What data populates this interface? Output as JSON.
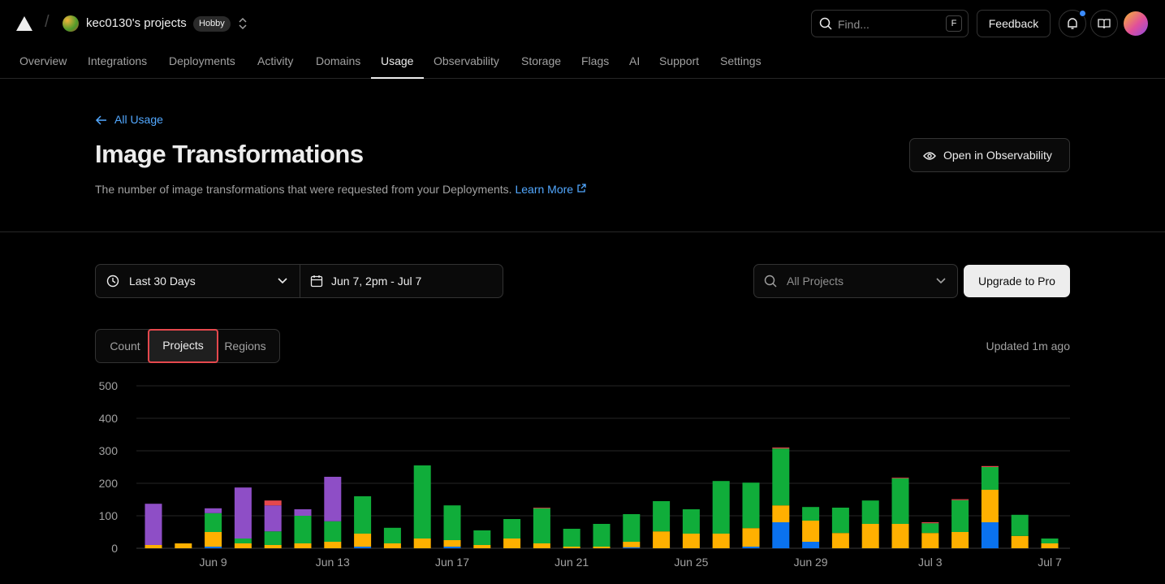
{
  "header": {
    "team_name": "kec0130's projects",
    "plan_badge": "Hobby",
    "search_placeholder": "Find...",
    "search_shortcut": "F",
    "feedback_label": "Feedback"
  },
  "nav": {
    "items": [
      "Overview",
      "Integrations",
      "Deployments",
      "Activity",
      "Domains",
      "Usage",
      "Observability",
      "Storage",
      "Flags",
      "AI",
      "Support",
      "Settings"
    ],
    "active": "Usage"
  },
  "page": {
    "back_label": "All Usage",
    "title": "Image Transformations",
    "description": "The number of image transformations that were requested from your Deployments.",
    "learn_more": "Learn More",
    "observability_button": "Open in Observability"
  },
  "filters": {
    "range": "Last 30 Days",
    "dates": "Jun 7, 2pm - Jul 7",
    "project_placeholder": "All Projects",
    "upgrade_button": "Upgrade to Pro"
  },
  "tabs": {
    "items": [
      "Count",
      "Projects",
      "Regions"
    ],
    "active": "Projects"
  },
  "updated_text": "Updated 1m ago",
  "colors": {
    "blue": "#0a72ef",
    "orange": "#ffb000",
    "green": "#10ad3a",
    "purple": "#8e4ec6",
    "red": "#e5484d",
    "link": "#52a8ff"
  },
  "chart_data": {
    "type": "bar",
    "stacked": true,
    "ylim": [
      0,
      500
    ],
    "yticks": [
      0,
      100,
      200,
      300,
      400,
      500
    ],
    "xtick_labels": [
      {
        "index": 2,
        "label": "Jun 9"
      },
      {
        "index": 6,
        "label": "Jun 13"
      },
      {
        "index": 10,
        "label": "Jun 17"
      },
      {
        "index": 14,
        "label": "Jun 21"
      },
      {
        "index": 18,
        "label": "Jun 25"
      },
      {
        "index": 22,
        "label": "Jun 29"
      },
      {
        "index": 26,
        "label": "Jul 3"
      },
      {
        "index": 30,
        "label": "Jul 7"
      }
    ],
    "categories": [
      "Jun 7",
      "Jun 8",
      "Jun 9",
      "Jun 10",
      "Jun 11",
      "Jun 12",
      "Jun 13",
      "Jun 14",
      "Jun 15",
      "Jun 16",
      "Jun 17",
      "Jun 18",
      "Jun 19",
      "Jun 20",
      "Jun 21",
      "Jun 22",
      "Jun 23",
      "Jun 24",
      "Jun 25",
      "Jun 26",
      "Jun 27",
      "Jun 28",
      "Jun 29",
      "Jun 30",
      "Jul 1",
      "Jul 2",
      "Jul 3",
      "Jul 4",
      "Jul 5",
      "Jul 6",
      "Jul 7"
    ],
    "series": [
      {
        "color": "#0a72ef",
        "values": [
          0,
          0,
          5,
          0,
          0,
          0,
          0,
          5,
          0,
          0,
          5,
          0,
          0,
          0,
          0,
          0,
          3,
          0,
          0,
          0,
          5,
          80,
          20,
          0,
          0,
          0,
          0,
          0,
          80,
          0,
          0
        ]
      },
      {
        "color": "#ffb000",
        "values": [
          10,
          15,
          45,
          15,
          10,
          15,
          20,
          40,
          15,
          30,
          20,
          10,
          30,
          15,
          5,
          5,
          17,
          52,
          45,
          45,
          57,
          52,
          65,
          47,
          75,
          75,
          47,
          50,
          100,
          38,
          15
        ]
      },
      {
        "color": "#10ad3a",
        "values": [
          0,
          0,
          58,
          15,
          42,
          85,
          63,
          115,
          48,
          225,
          107,
          45,
          60,
          108,
          55,
          70,
          85,
          93,
          75,
          162,
          140,
          175,
          42,
          78,
          72,
          140,
          30,
          98,
          70,
          65,
          15
        ]
      },
      {
        "color": "#8e4ec6",
        "values": [
          127,
          0,
          15,
          157,
          80,
          20,
          137,
          0,
          0,
          0,
          0,
          0,
          0,
          0,
          0,
          0,
          0,
          0,
          0,
          0,
          0,
          0,
          0,
          0,
          0,
          0,
          0,
          0,
          0,
          0,
          0
        ]
      },
      {
        "color": "#e5484d",
        "values": [
          0,
          0,
          0,
          0,
          15,
          0,
          0,
          0,
          0,
          0,
          0,
          0,
          0,
          2,
          0,
          0,
          0,
          0,
          0,
          0,
          0,
          3,
          0,
          0,
          0,
          2,
          3,
          3,
          3,
          0,
          0
        ]
      }
    ]
  }
}
